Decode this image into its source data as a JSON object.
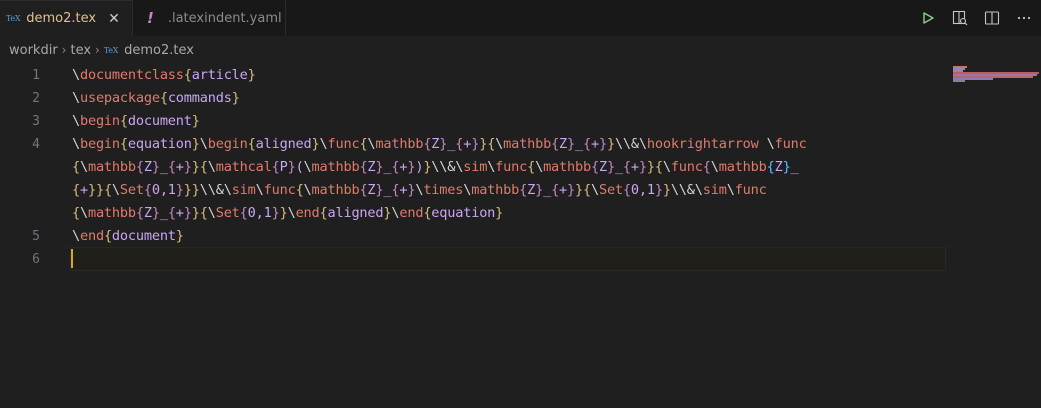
{
  "tabs": [
    {
      "label": "demo2.tex",
      "icon": "tex-icon",
      "active": true
    },
    {
      "label": ".latexindent.yaml",
      "icon": "exclamation-icon",
      "active": false
    }
  ],
  "tex_icon_text": "TeX",
  "close_glyph": "✕",
  "yaml_glyph": "!",
  "breadcrumb": {
    "items": [
      "workdir",
      "tex",
      "demo2.tex"
    ],
    "separator": "›"
  },
  "line_numbers": [
    "1",
    "2",
    "3",
    "4",
    "5",
    "6"
  ],
  "code_lines": [
    "\\documentclass{article}",
    "\\usepackage{commands}",
    "\\begin{document}",
    "\\begin{equation}\\begin{aligned}\\func{\\mathbb{Z}_{+}}{\\mathbb{Z}_{+}}\\\\&\\hookrightarrow \\func",
    "{\\mathbb{Z}_{+}}{\\mathcal{P}(\\mathbb{Z}_{+})}\\\\&\\sim\\func{\\mathbb{Z}_{+}}{\\func{\\mathbb{Z}_",
    "{+}}{\\Set{0,1}}}\\\\&\\sim\\func{\\mathbb{Z}_{+}\\times\\mathbb{Z}_{+}}{\\Set{0,1}}\\\\&\\sim\\func",
    "{\\mathbb{Z}_{+}}{\\Set{0,1}}\\end{aligned}\\end{equation}",
    "\\end{document}",
    ""
  ],
  "colors": {
    "active_tab_text": "#e2c08d",
    "command": "#e07b6b",
    "brace": "#d7ba7d",
    "argument": "#c9a6f3",
    "cursor": "#d4a82a",
    "run_icon": "#89d185"
  }
}
